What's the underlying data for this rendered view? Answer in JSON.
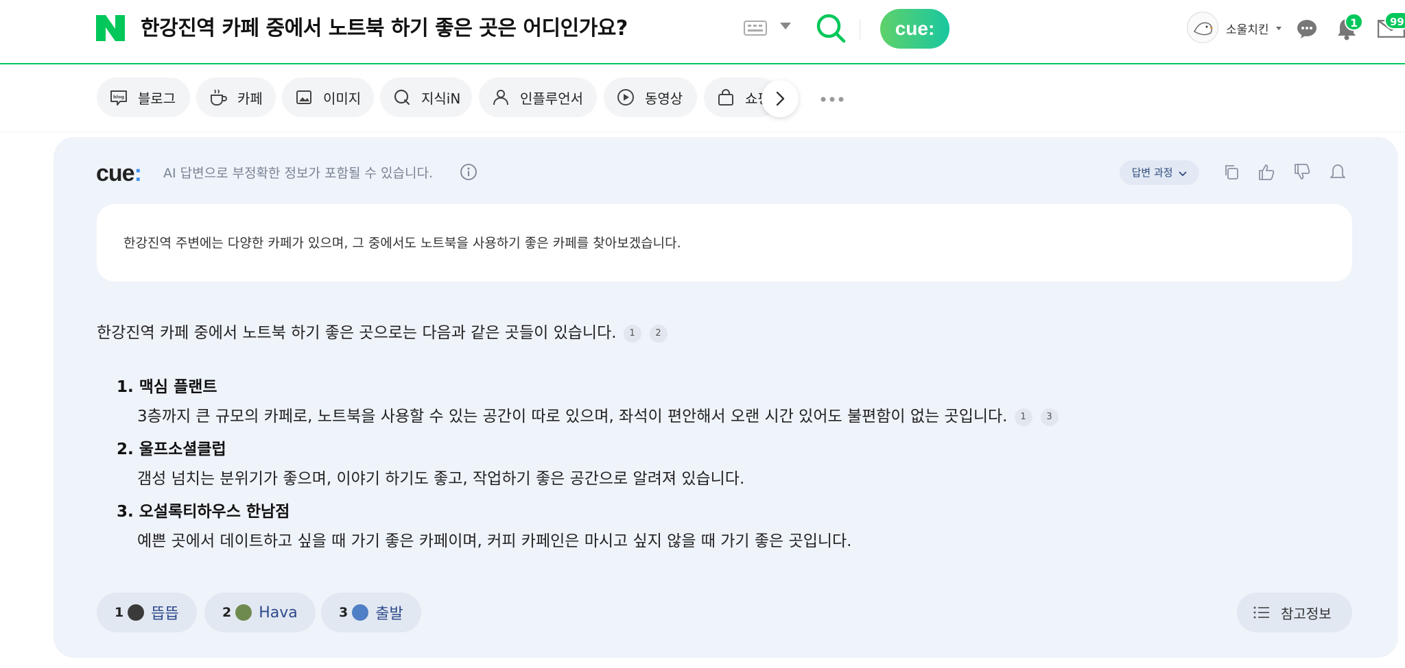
{
  "header": {
    "query": "한강진역 카페 중에서 노트북 하기 좋은 곳은 어디인가요?",
    "cue_label": "cue:",
    "username": "소울치킨",
    "notification_count": "1",
    "mail_count": "99"
  },
  "tabs": [
    {
      "label": "블로그",
      "icon": "blog-icon"
    },
    {
      "label": "카페",
      "icon": "cafe-cup-icon"
    },
    {
      "label": "이미지",
      "icon": "image-icon"
    },
    {
      "label": "지식iN",
      "icon": "kin-icon"
    },
    {
      "label": "인플루언서",
      "icon": "person-icon"
    },
    {
      "label": "동영상",
      "icon": "play-icon"
    },
    {
      "label": "쇼핑",
      "icon": "shopping-bag-icon"
    }
  ],
  "cue": {
    "logo": "cue",
    "logo_dot": ":",
    "disclaimer": "AI 답변으로 부정확한 정보가 포함될 수 있습니다.",
    "process_label": "답변 과정",
    "summary": "한강진역 주변에는 다양한 카페가 있으며, 그 중에서도 노트북을 사용하기 좋은 카페를 찾아보겠습니다.",
    "lead": "한강진역 카페 중에서 노트북 하기 좋은 곳으로는 다음과 같은 곳들이 있습니다.",
    "lead_refs": [
      "1",
      "2"
    ],
    "items": [
      {
        "title": "1. 맥심 플랜트",
        "desc": "3층까지 큰 규모의 카페로, 노트북을 사용할 수 있는 공간이 따로 있으며, 좌석이 편안해서 오랜 시간 있어도 불편함이 없는 곳입니다.",
        "refs": [
          "1",
          "3"
        ]
      },
      {
        "title": "2. 울프소셜클럽",
        "desc": "갬성 넘치는 분위기가 좋으며, 이야기 하기도 좋고, 작업하기 좋은 공간으로 알려져 있습니다.",
        "refs": []
      },
      {
        "title": "3. 오설록티하우스 한남점",
        "desc": "예쁜 곳에서 데이트하고 싶을 때 가기 좋은 카페이며, 커피 카페인은 마시고 싶지 않을 때 가기 좋은 곳입니다.",
        "refs": []
      }
    ],
    "sources": [
      {
        "num": "1",
        "name": "뜹뜹",
        "color": "#3a3a3a"
      },
      {
        "num": "2",
        "name": "Hava",
        "color": "#6f8a4e"
      },
      {
        "num": "3",
        "name": "출발",
        "color": "#4f7fc4"
      }
    ],
    "reference_label": "참고정보"
  },
  "colors": {
    "brand_green": "#03c75a",
    "panel_bg": "#eff3fa",
    "link_blue": "#2d4a8a"
  }
}
